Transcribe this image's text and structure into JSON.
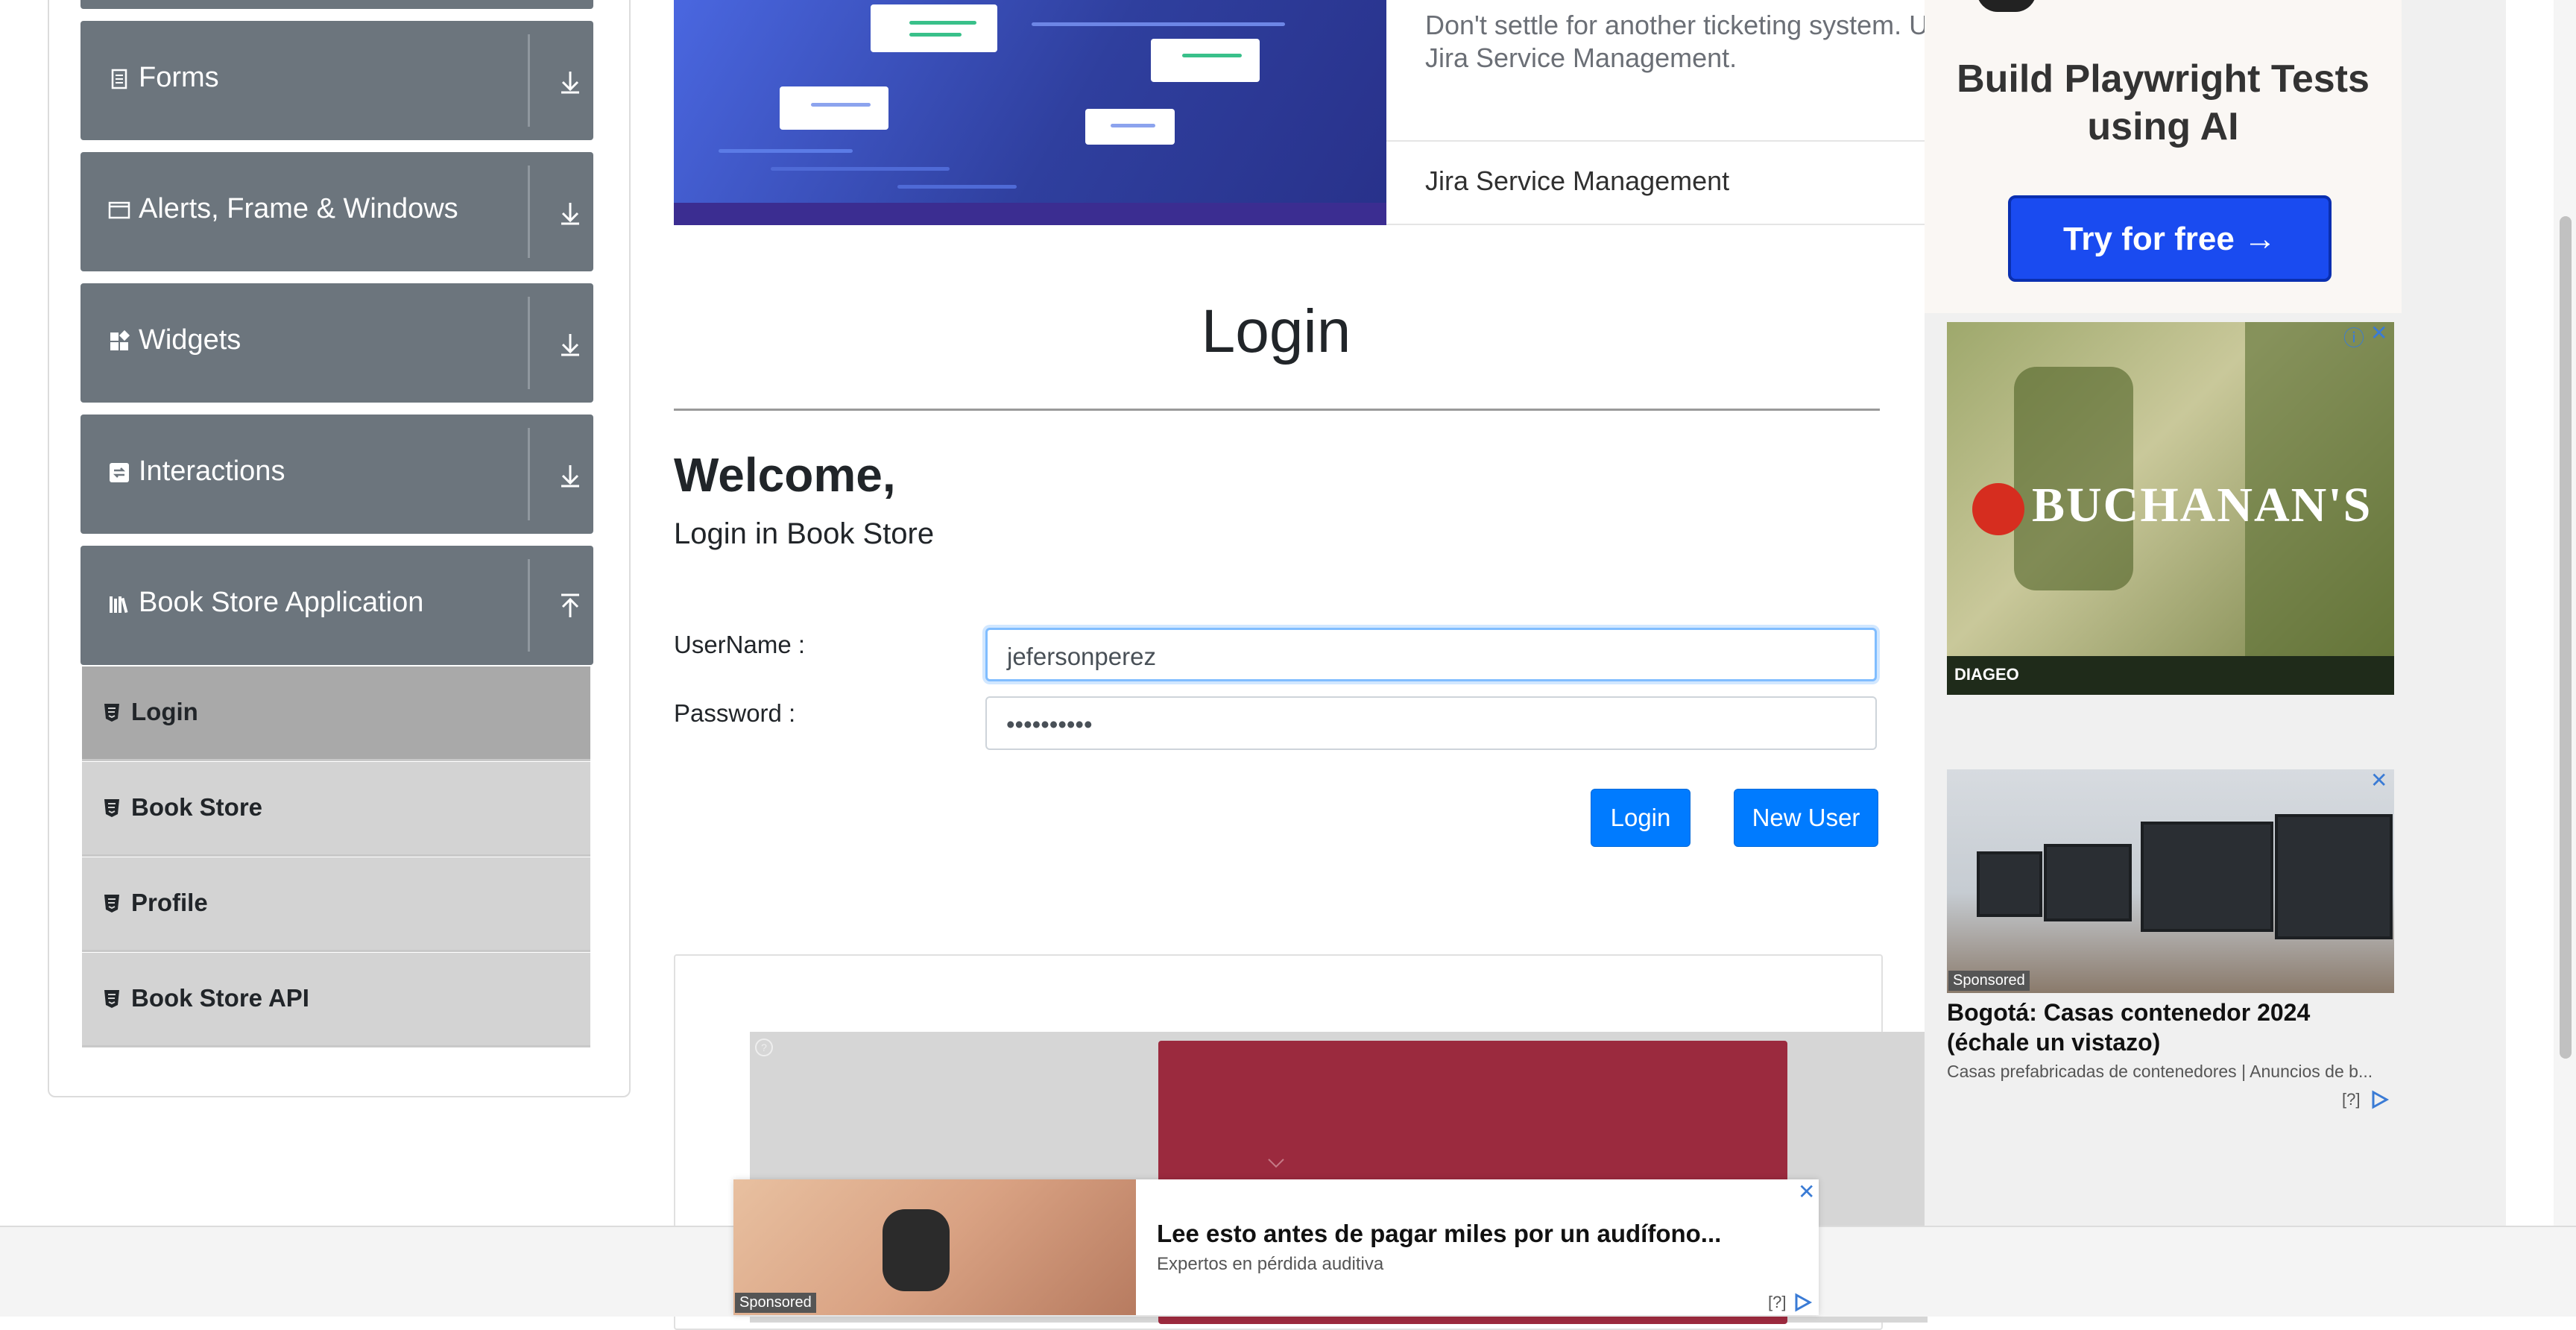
{
  "sidebar": {
    "groups": [
      {
        "label": "Forms"
      },
      {
        "label": "Alerts, Frame & Windows"
      },
      {
        "label": "Widgets"
      },
      {
        "label": "Interactions"
      },
      {
        "label": "Book Store Application"
      }
    ],
    "items": [
      {
        "label": "Login",
        "active": true
      },
      {
        "label": "Book Store"
      },
      {
        "label": "Profile"
      },
      {
        "label": "Book Store API"
      }
    ]
  },
  "banner": {
    "description": "Don't settle for another ticketing system. U Jira Service Management.",
    "product": "Jira Service Management"
  },
  "login": {
    "title": "Login",
    "welcome": "Welcome,",
    "subtitle": "Login in Book Store",
    "username_label": "UserName :",
    "username_value": "jefersonperez",
    "password_label": "Password :",
    "password_value": "••••••••••",
    "login_button": "Login",
    "new_user_button": "New User"
  },
  "ads": {
    "playwright_title": "Build Playwright Tests using AI",
    "playwright_button": "Try for free →",
    "buchanans_brand": "BUCHANAN'S",
    "buchanans_footer": "DIAGEO",
    "house_sponsored": "Sponsored",
    "house_title": "Bogotá: Casas contenedor 2024 (échale un vistazo)",
    "house_sub": "Casas prefabricadas de contenedores | Anuncios de b...",
    "adchoice": "[?]",
    "bottom_sponsored": "Sponsored",
    "bottom_title": "Lee esto antes de pagar miles por un audífono...",
    "bottom_sub": "Expertos en pérdida auditiva",
    "close": "✕"
  },
  "colors": {
    "group_bg": "#6c757d",
    "submenu_bg": "#d3d3d3",
    "submenu_active_bg": "#a9a9a9",
    "primary": "#007bff"
  }
}
